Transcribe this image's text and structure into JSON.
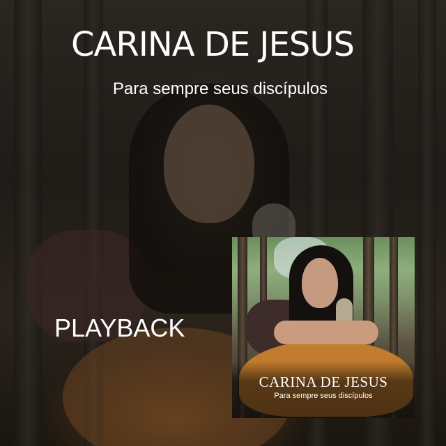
{
  "cover": {
    "title": "CARINA DE JESUS",
    "subtitle": "Para sempre seus discípulos",
    "label": "PLAYBACK"
  },
  "album_art": {
    "title": "CARINA DE JESUS",
    "subtitle": "Para sempre seus discípulos"
  }
}
